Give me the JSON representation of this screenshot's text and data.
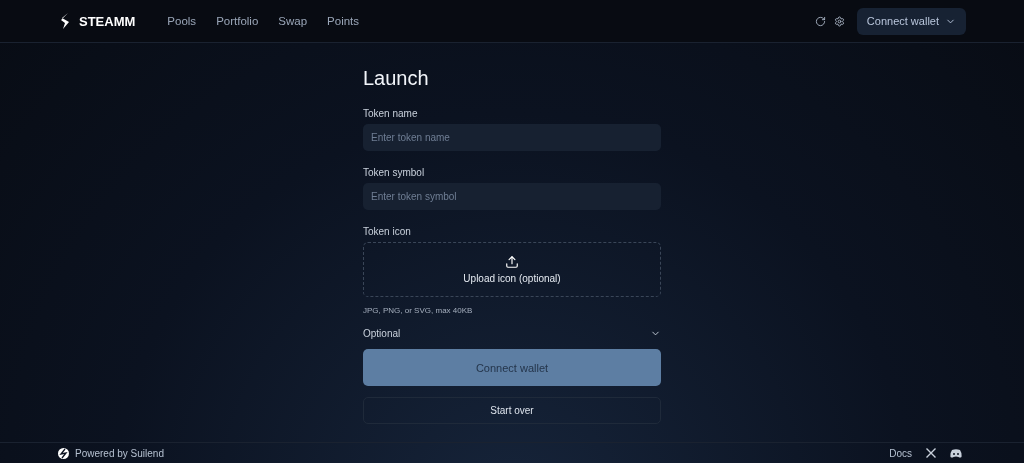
{
  "header": {
    "brand": "STEAMM",
    "nav": [
      {
        "label": "Pools",
        "selected": false
      },
      {
        "label": "Portfolio",
        "selected": false
      },
      {
        "label": "Swap",
        "selected": false
      },
      {
        "label": "Points",
        "selected": false
      }
    ],
    "wallet_button": "Connect wallet"
  },
  "title": "Launch",
  "fields": [
    {
      "label": "Token name",
      "placeholder": "Enter token name"
    },
    {
      "label": "Token symbol",
      "placeholder": "Enter token symbol"
    }
  ],
  "icon_upload": {
    "label": "Token icon",
    "button": "Upload icon (optional)",
    "hint": "JPG, PNG, or SVG, max 40KB"
  },
  "optional": {
    "label": "Optional",
    "expanded": false
  },
  "primary_button": {
    "label": "Connect wallet",
    "disabled": true
  },
  "secondary_button": "Start over",
  "footer": {
    "powered_by": "Powered by Suilend",
    "links": [
      "Docs"
    ]
  }
}
